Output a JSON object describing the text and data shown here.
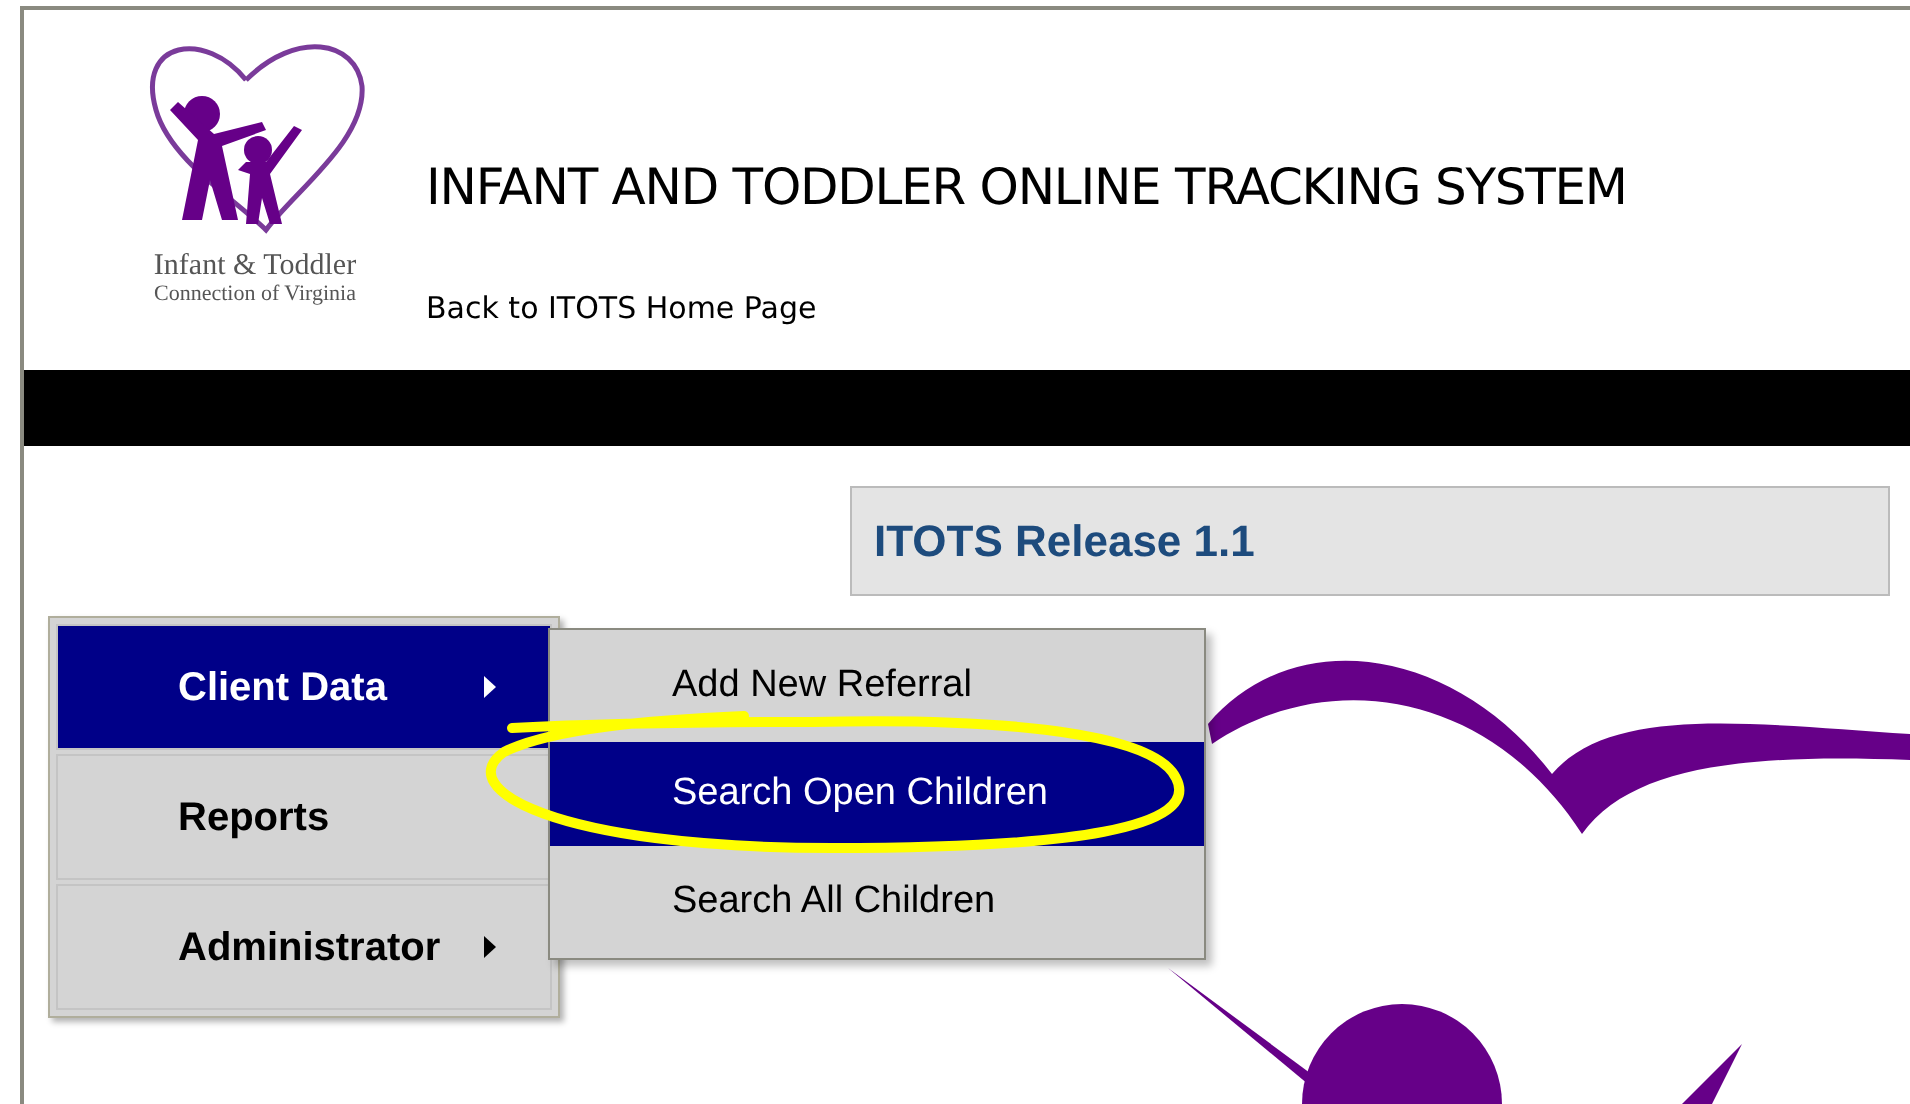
{
  "logo": {
    "line1": "Infant & Toddler",
    "line2": "Connection of Virginia"
  },
  "header": {
    "title": "INFANT AND TODDLER ONLINE TRACKING SYSTEM",
    "home_link": "Back to ITOTS Home Page"
  },
  "release_banner": "ITOTS Release 1.1",
  "menu": [
    {
      "label": "Client Data",
      "selected": true,
      "has_submenu": true
    },
    {
      "label": "Reports",
      "selected": false,
      "has_submenu": false
    },
    {
      "label": "Administrator",
      "selected": false,
      "has_submenu": true
    }
  ],
  "submenu": [
    {
      "label": "Add New Referral",
      "selected": false
    },
    {
      "label": "Search Open Children",
      "selected": true
    },
    {
      "label": "Search All Children",
      "selected": false
    }
  ]
}
